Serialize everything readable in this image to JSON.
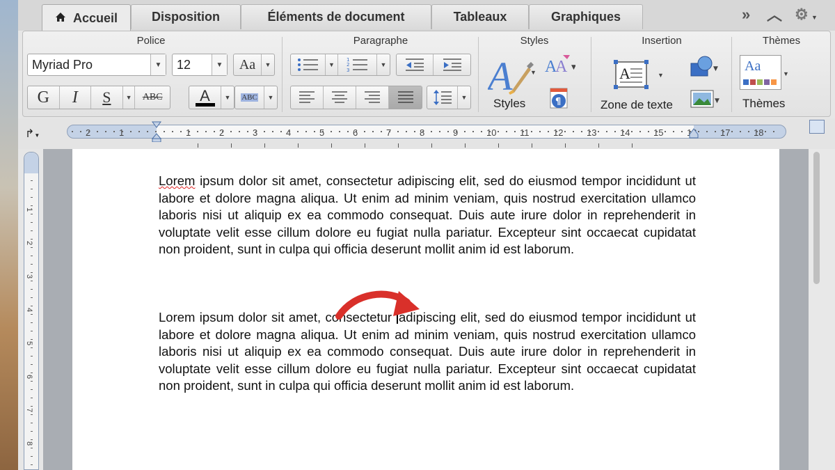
{
  "tabs": {
    "items": [
      "Accueil",
      "Disposition",
      "Éléments de document",
      "Tableaux",
      "Graphiques"
    ],
    "active": "Accueil",
    "controls": [
      "»",
      "︿",
      "⚙"
    ]
  },
  "ribbon": {
    "police": {
      "title": "Police",
      "font_name": "Myriad Pro",
      "font_size": "12",
      "format_buttons": [
        "G",
        "I",
        "S",
        "ABC"
      ],
      "color_letter": "A",
      "highlight_label": "ABC",
      "color_accent": "#000000"
    },
    "paragraphe": {
      "title": "Paragraphe"
    },
    "styles": {
      "title": "Styles",
      "button_label": "Styles"
    },
    "insertion": {
      "title": "Insertion",
      "textbox_label": "Zone de texte"
    },
    "themes": {
      "title": "Thèmes",
      "button_label": "Thèmes",
      "preview_text": "Aa"
    }
  },
  "ruler": {
    "labels": [
      "2",
      "1",
      "1",
      "2",
      "3",
      "4",
      "5",
      "6",
      "7",
      "8",
      "9",
      "10",
      "11",
      "12",
      "13",
      "14",
      "15",
      "16",
      "17",
      "18"
    ]
  },
  "vertical_ruler": {
    "labels": [
      "1",
      "2",
      "3",
      "4",
      "5",
      "6",
      "7",
      "8"
    ]
  },
  "document": {
    "para1_first": "Lorem",
    "para1_rest": " ipsum dolor sit amet, consectetur adipiscing elit, sed do eiusmod tempor incididunt ut labore et dolore magna aliqua. Ut enim ad minim veniam, quis nostrud exercitation ullamco laboris nisi ut aliquip ex ea commodo consequat. Duis aute irure dolor in reprehenderit in voluptate velit esse cillum dolore eu fugiat nulla pariatur. Excepteur sint occaecat cupidatat non proident, sunt in culpa qui officia deserunt mollit anim id est laborum.",
    "para2_before_cursor": "Lorem ipsum dolor sit amet, consectetur ",
    "para2_after_cursor": "adipiscing elit, sed do eiusmod tempor incididunt ut labore et dolore magna aliqua. Ut enim ad minim veniam, quis nostrud exercitation ullamco laboris nisi ut aliquip ex ea commodo consequat. Duis aute irure dolor in reprehenderit in voluptate velit esse cillum dolore eu fugiat nulla pariatur. Excepteur sint occaecat cupidatat non proident, sunt in culpa qui officia deserunt mollit anim id est laborum."
  },
  "colors": {
    "arrow": "#d9302a",
    "ruler_blue": "#c4d2e6",
    "spell_underline": "#e02020"
  }
}
